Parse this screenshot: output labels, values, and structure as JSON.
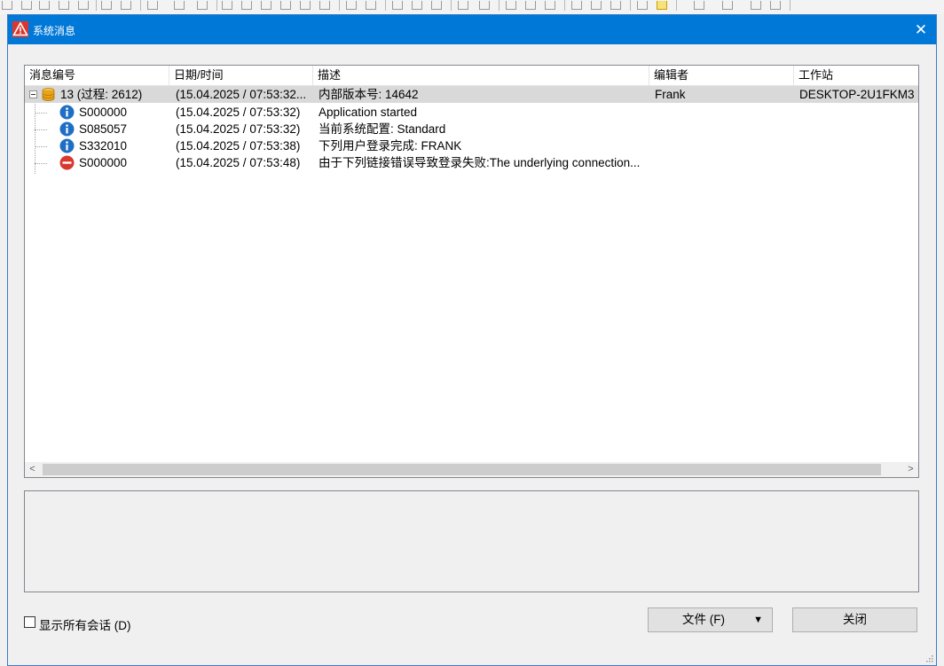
{
  "window": {
    "title": "系统消息",
    "close_glyph": "✕",
    "title_icon": "warning-triangle-icon",
    "accent": "#0078d7"
  },
  "table": {
    "columns": [
      "消息编号",
      "日期/时间",
      "描述",
      "编辑者",
      "工作站"
    ],
    "rows": [
      {
        "icon": "database-icon",
        "number": "13 (过程: 2612)",
        "datetime": "(15.04.2025 / 07:53:32...",
        "description": "内部版本号: 14642",
        "editor": "Frank",
        "workstation": "DESKTOP-2U1FKM3",
        "selected": true,
        "level": 0
      },
      {
        "icon": "info-icon",
        "number": "S000000",
        "datetime": "(15.04.2025 / 07:53:32)",
        "description": "Application started",
        "editor": "",
        "workstation": "",
        "level": 1
      },
      {
        "icon": "info-icon",
        "number": "S085057",
        "datetime": "(15.04.2025 / 07:53:32)",
        "description": "当前系统配置: Standard",
        "editor": "",
        "workstation": "",
        "level": 1
      },
      {
        "icon": "info-icon",
        "number": "S332010",
        "datetime": "(15.04.2025 / 07:53:38)",
        "description": "下列用户登录完成: FRANK",
        "editor": "",
        "workstation": "",
        "level": 1
      },
      {
        "icon": "error-icon",
        "number": "S000000",
        "datetime": "(15.04.2025 / 07:53:48)",
        "description": "由于下列链接错误导致登录失败:The underlying connection...",
        "editor": "",
        "workstation": "",
        "level": 1
      }
    ]
  },
  "scrollbar": {
    "left": "<",
    "right": ">"
  },
  "footer": {
    "show_all_label": "显示所有会话 (D)",
    "show_all_checked": false,
    "file_button": "文件 (F)",
    "file_dropdown": "▼",
    "close_button": "关闭"
  },
  "colors": {
    "info": "#1e6fc4",
    "error": "#d9382f",
    "database": "#e8a317",
    "selected_row": "#d9d9d9"
  }
}
